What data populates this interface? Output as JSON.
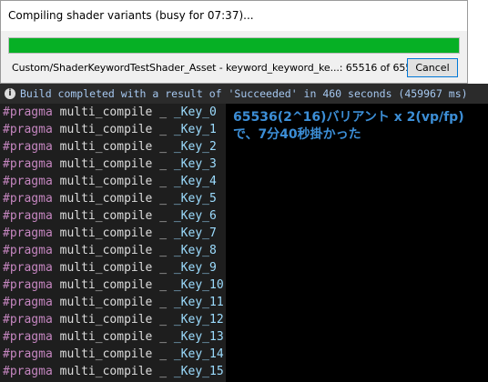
{
  "dialog": {
    "title": "Compiling shader variants (busy for 07:37)...",
    "progress_fraction": 0.9999,
    "status": "Custom/ShaderKeywordTestShader_Asset - keyword_keyword_ke...: 65516 of 65536 fp",
    "cancel_label": "Cancel"
  },
  "console": {
    "build_message": "Build completed with a result of 'Succeeded' in 460 seconds (459967 ms)",
    "lines": [
      {
        "kw": "#pragma",
        "fn": "multi_compile _ ",
        "key": "_Key_0"
      },
      {
        "kw": "#pragma",
        "fn": "multi_compile _ ",
        "key": "_Key_1"
      },
      {
        "kw": "#pragma",
        "fn": "multi_compile _ ",
        "key": "_Key_2"
      },
      {
        "kw": "#pragma",
        "fn": "multi_compile _ ",
        "key": "_Key_3"
      },
      {
        "kw": "#pragma",
        "fn": "multi_compile _ ",
        "key": "_Key_4"
      },
      {
        "kw": "#pragma",
        "fn": "multi_compile _ ",
        "key": "_Key_5"
      },
      {
        "kw": "#pragma",
        "fn": "multi_compile _ ",
        "key": "_Key_6"
      },
      {
        "kw": "#pragma",
        "fn": "multi_compile _ ",
        "key": "_Key_7"
      },
      {
        "kw": "#pragma",
        "fn": "multi_compile _ ",
        "key": "_Key_8"
      },
      {
        "kw": "#pragma",
        "fn": "multi_compile _ ",
        "key": "_Key_9"
      },
      {
        "kw": "#pragma",
        "fn": "multi_compile _ ",
        "key": "_Key_10"
      },
      {
        "kw": "#pragma",
        "fn": "multi_compile _ ",
        "key": "_Key_11"
      },
      {
        "kw": "#pragma",
        "fn": "multi_compile _ ",
        "key": "_Key_12"
      },
      {
        "kw": "#pragma",
        "fn": "multi_compile _ ",
        "key": "_Key_13"
      },
      {
        "kw": "#pragma",
        "fn": "multi_compile _ ",
        "key": "_Key_14"
      },
      {
        "kw": "#pragma",
        "fn": "multi_compile _ ",
        "key": "_Key_15"
      }
    ]
  },
  "annotation": {
    "line1": "65536(2^16)バリアント x 2(vp/fp)",
    "line2": "で、7分40秒掛かった"
  },
  "colors": {
    "progress_green": "#06b025",
    "pragma": "#c586c0",
    "key": "#9cdcfe",
    "annotation": "#3c8ed6"
  },
  "icons": {
    "build_status": "info-icon"
  }
}
